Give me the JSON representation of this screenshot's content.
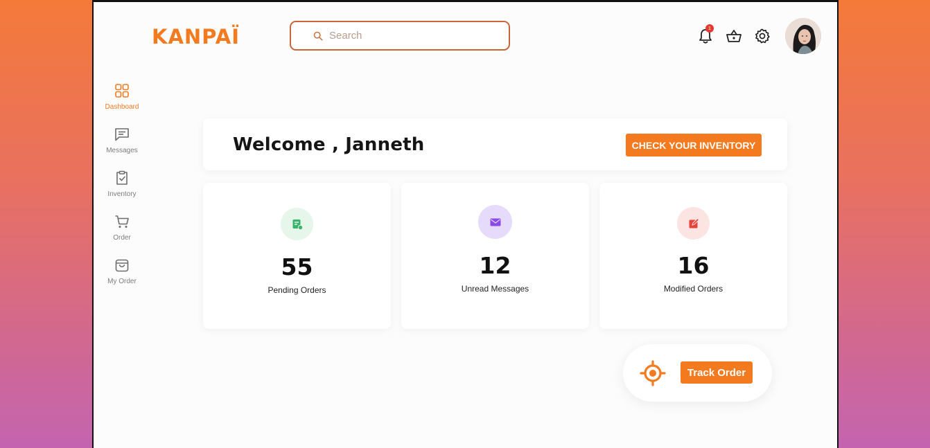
{
  "app": {
    "logo_text": "KANPAÏ",
    "brand_color": "#f47a20"
  },
  "search": {
    "placeholder": "Search",
    "value": ""
  },
  "header_icons": {
    "notifications_count": "1",
    "icons": [
      "bell-icon",
      "basket-icon",
      "gear-icon"
    ]
  },
  "sidebar": {
    "items": [
      {
        "label": "Dashboard",
        "icon": "dashboard-grid-icon",
        "active": true
      },
      {
        "label": "Messages",
        "icon": "message-icon",
        "active": false
      },
      {
        "label": "Inventory",
        "icon": "clipboard-check-icon",
        "active": false
      },
      {
        "label": "Order",
        "icon": "cart-icon",
        "active": false
      },
      {
        "label": "My Order",
        "icon": "bag-icon",
        "active": false
      }
    ]
  },
  "welcome": {
    "text": "Welcome , Janneth",
    "button_label": "CHECK YOUR INVENTORY"
  },
  "stats": [
    {
      "value": "55",
      "label": "Pending Orders",
      "icon": "order-list-icon",
      "icon_bg": "#e6f6ea",
      "icon_color": "#3bb36a"
    },
    {
      "value": "12",
      "label": "Unread Messages",
      "icon": "envelope-icon",
      "icon_bg": "#e6dbfb",
      "icon_color": "#8a4be8"
    },
    {
      "value": "16",
      "label": "Modified Orders",
      "icon": "edit-icon",
      "icon_bg": "#fbe4e1",
      "icon_color": "#e8433b"
    }
  ],
  "track": {
    "button_label": "Track Order",
    "icon": "target-icon"
  }
}
